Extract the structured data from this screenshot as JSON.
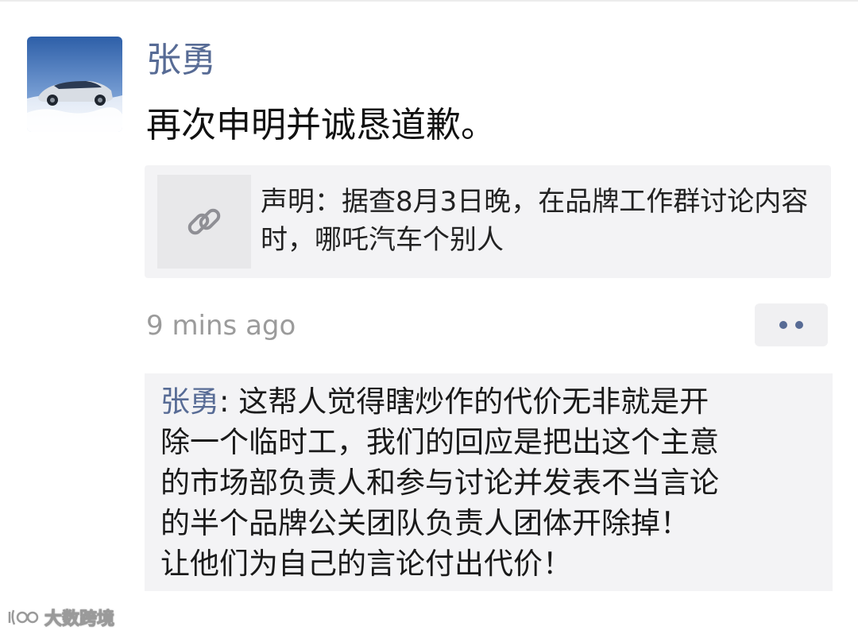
{
  "post": {
    "author": "张勇",
    "text": "再次申明并诚恳道歉。",
    "link_card": {
      "icon": "link-icon",
      "title": "声明：据查8月3日晚，在品牌工作群讨论内容时，哪吒汽车个别人"
    },
    "time": "9 mins ago",
    "more_icon": "more-dots-icon"
  },
  "comment": {
    "author": "张勇",
    "separator": ": ",
    "lines": [
      "这帮人觉得瞎炒作的代价无非就是开",
      "除一个临时工，我们的回应是把出这个主意",
      "的市场部负责人和参与讨论并发表不当言论",
      "的半个品牌公关团队负责人团体开除掉！",
      "让他们为自己的言论付出代价！"
    ]
  },
  "watermark": {
    "text": "大数跨境"
  },
  "colors": {
    "name_link": "#576b95",
    "card_bg": "#f3f3f5",
    "time_gray": "#9b9b9b"
  }
}
